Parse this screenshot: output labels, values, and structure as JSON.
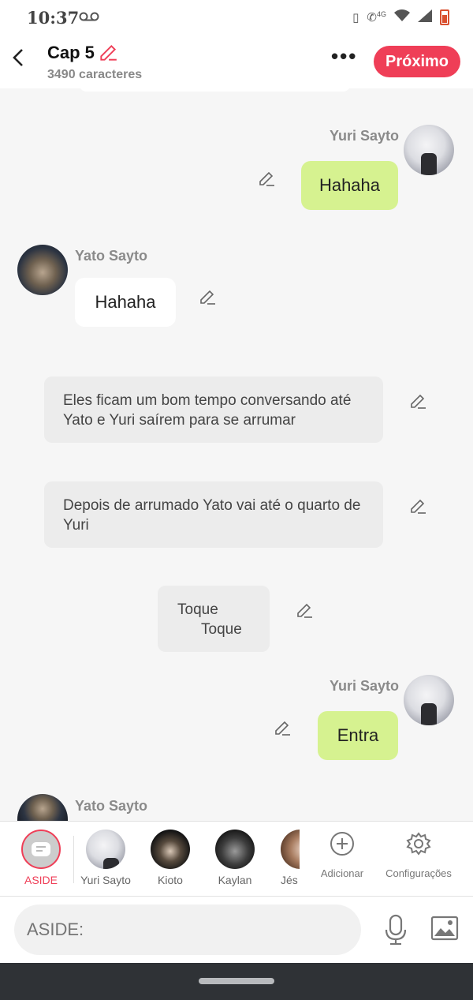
{
  "status": {
    "time": "10:37",
    "voicemail": "oo",
    "network": "4G"
  },
  "header": {
    "title": "Cap 5",
    "subtitle": "3490 caracteres",
    "next_label": "Próximo",
    "more": "•••"
  },
  "messages": [
    {
      "type": "right",
      "sender": "Yuri Sayto",
      "text": "Hahaha"
    },
    {
      "type": "left",
      "sender": "Yato Sayto",
      "text": "Hahaha"
    },
    {
      "type": "narration",
      "text": "Eles ficam um bom tempo conversando até Yato e Yuri saírem para se arrumar"
    },
    {
      "type": "narration",
      "text": "Depois de arrumado Yato vai até o quarto de Yuri"
    },
    {
      "type": "narration",
      "line1": "Toque",
      "line2": "Toque"
    },
    {
      "type": "right",
      "sender": "Yuri Sayto",
      "text": "Entra"
    },
    {
      "type": "left",
      "sender": "Yato Sayto"
    }
  ],
  "characters": [
    {
      "name": "ASIDE",
      "selected": true
    },
    {
      "name": "Yuri Sayto"
    },
    {
      "name": "Kioto"
    },
    {
      "name": "Kaylan"
    },
    {
      "name": "Jés"
    }
  ],
  "tools": {
    "add": "Adicionar",
    "settings": "Configurações"
  },
  "input": {
    "placeholder": "ASIDE:"
  },
  "colors": {
    "accent": "#ef3e57",
    "bubble_green": "#d6f290"
  }
}
